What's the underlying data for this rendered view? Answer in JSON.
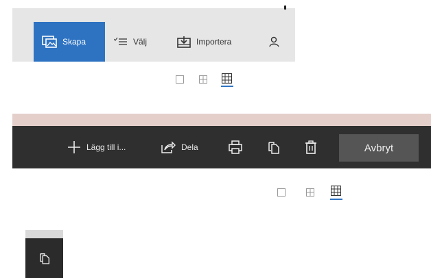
{
  "top_toolbar": {
    "create_label": "Skapa",
    "select_label": "Välj",
    "import_label": "Importera",
    "icons": {
      "create": "image-create-icon",
      "select": "select-list-icon",
      "import": "import-icon",
      "person": "person-icon"
    }
  },
  "view_toggle_top": {
    "options": [
      "single-view-icon",
      "four-grid-view-icon",
      "many-grid-view-icon"
    ],
    "selected": "many-grid-view-icon"
  },
  "dark_toolbar": {
    "add_label": "Lägg till i...",
    "share_label": "Dela",
    "cancel_label": "Avbryt",
    "icons": {
      "add": "plus-icon",
      "share": "share-icon",
      "print": "print-icon",
      "copy": "copy-icon",
      "delete": "trash-icon"
    }
  },
  "view_toggle_bottom": {
    "options": [
      "single-view-icon",
      "four-grid-view-icon",
      "many-grid-view-icon"
    ],
    "selected": "many-grid-view-icon"
  },
  "colors": {
    "accent": "#2e73c2",
    "dark_bar": "#2f2f2f",
    "light_bar": "#e6e6e6",
    "pink_band": "#e5cfcb",
    "cancel_button": "#555555"
  }
}
